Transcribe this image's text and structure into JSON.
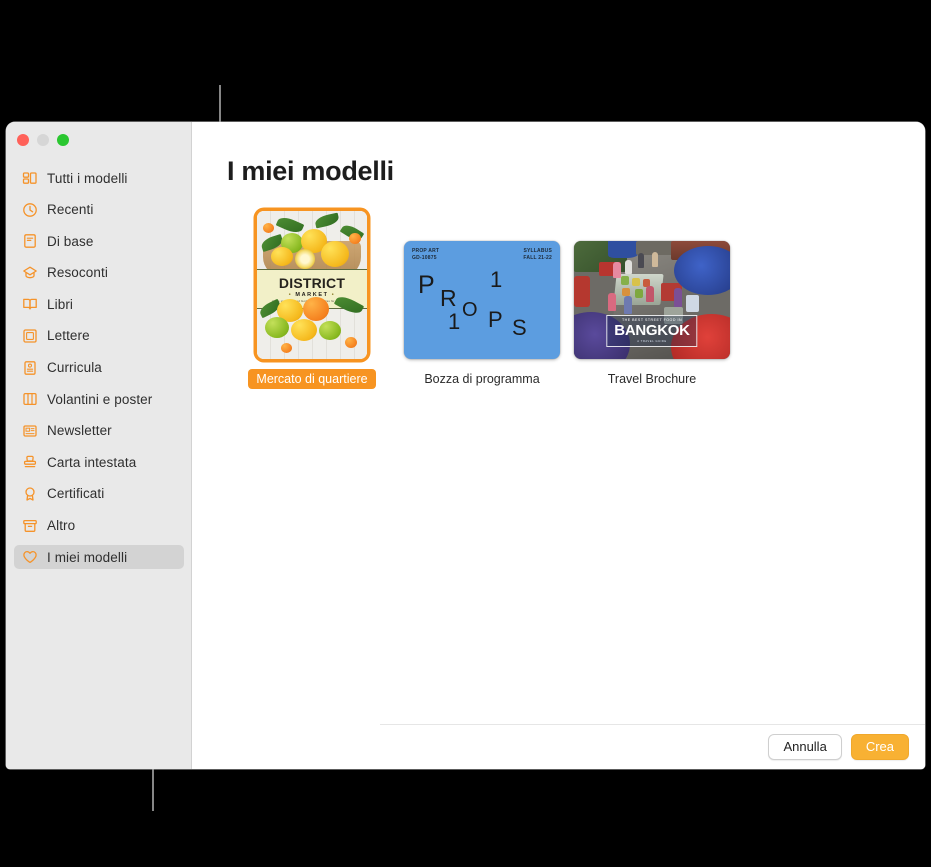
{
  "window": {
    "traffic_lights": [
      "close",
      "minimize",
      "zoom"
    ]
  },
  "sidebar": {
    "items": [
      {
        "label": "Tutti i modelli",
        "icon": "grid-icon",
        "selected": false
      },
      {
        "label": "Recenti",
        "icon": "clock-icon",
        "selected": false
      },
      {
        "label": "Di base",
        "icon": "document-icon",
        "selected": false
      },
      {
        "label": "Resoconti",
        "icon": "report-icon",
        "selected": false
      },
      {
        "label": "Libri",
        "icon": "book-icon",
        "selected": false
      },
      {
        "label": "Lettere",
        "icon": "letter-icon",
        "selected": false
      },
      {
        "label": "Curricula",
        "icon": "resume-icon",
        "selected": false
      },
      {
        "label": "Volantini e poster",
        "icon": "flyer-icon",
        "selected": false
      },
      {
        "label": "Newsletter",
        "icon": "newspaper-icon",
        "selected": false
      },
      {
        "label": "Carta intestata",
        "icon": "stamp-icon",
        "selected": false
      },
      {
        "label": "Certificati",
        "icon": "award-icon",
        "selected": false
      },
      {
        "label": "Altro",
        "icon": "archive-icon",
        "selected": false
      },
      {
        "label": "I miei modelli",
        "icon": "heart-icon",
        "selected": true
      }
    ]
  },
  "main": {
    "title": "I miei modelli",
    "templates": [
      {
        "name": "Mercato di quartiere",
        "selected": true,
        "thumb": {
          "kind": "poster",
          "headline": "DISTRICT",
          "subhead": "MARKET",
          "tagline": "Home style prepared foods and necessities for your kitchen"
        }
      },
      {
        "name": "Bozza di programma",
        "selected": false,
        "thumb": {
          "kind": "syllabus",
          "corner_left": "PROP ART\nGD-10875",
          "corner_right": "SYLLABUS\nFALL 21-22",
          "scatter_letters": [
            "P",
            "R",
            "O",
            "P",
            "S",
            "1",
            "1"
          ],
          "bg_color": "#5c9de0"
        }
      },
      {
        "name": "Travel Brochure",
        "selected": false,
        "thumb": {
          "kind": "photo",
          "overlay_kicker": "THE BEST STREET FOOD IN",
          "overlay_title": "BANGKOK",
          "overlay_sub": "A TRAVEL GUIDE"
        }
      }
    ]
  },
  "footer": {
    "cancel_label": "Annulla",
    "create_label": "Crea"
  },
  "colors": {
    "accent": "#f79421",
    "create_button": "#f8b133",
    "sidebar_icon": "#f5932a",
    "selection_row": "#d3d3d3"
  }
}
